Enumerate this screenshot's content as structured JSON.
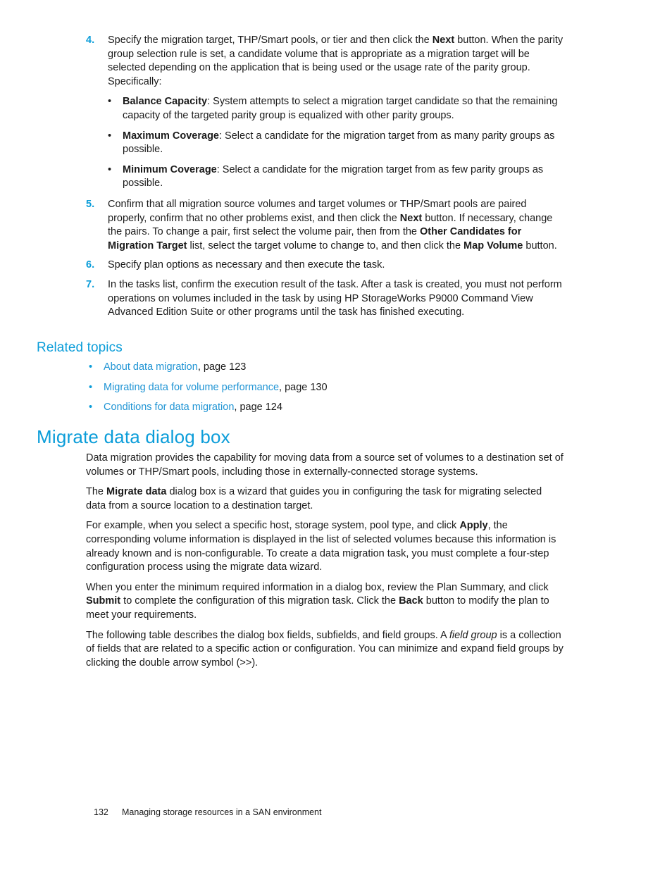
{
  "colors": {
    "accent_blue": "#0b9dd9",
    "link_blue": "#1f94d4",
    "body_text": "#1a1a1a",
    "page_background": "#ffffff"
  },
  "procedure": {
    "steps": [
      {
        "number": "4.",
        "text_parts": [
          {
            "text": "Specify the migration target, THP/Smart pools, or tier and then click the ",
            "style": "normal"
          },
          {
            "text": "Next",
            "style": "bold"
          },
          {
            "text": " button. When the parity group selection rule is set, a candidate volume that is appropriate as a migration target will be selected depending on the application that is being used or the usage rate of the parity group. Specifically:",
            "style": "normal"
          }
        ],
        "sub_items": [
          {
            "bullet": "•",
            "parts": [
              {
                "text": "Balance Capacity",
                "style": "bold"
              },
              {
                "text": ": System attempts to select a migration target candidate so that the remaining capacity of the targeted parity group is equalized with other parity groups.",
                "style": "normal"
              }
            ]
          },
          {
            "bullet": "•",
            "parts": [
              {
                "text": "Maximum Coverage",
                "style": "bold"
              },
              {
                "text": ": Select a candidate for the migration target from as many parity groups as possible.",
                "style": "normal"
              }
            ]
          },
          {
            "bullet": "•",
            "parts": [
              {
                "text": "Minimum Coverage",
                "style": "bold"
              },
              {
                "text": ": Select a candidate for the migration target from as few parity groups as possible.",
                "style": "normal"
              }
            ]
          }
        ]
      },
      {
        "number": "5.",
        "text_parts": [
          {
            "text": "Confirm that all migration source volumes and target volumes or THP/Smart pools are paired properly, confirm that no other problems exist, and then click the ",
            "style": "normal"
          },
          {
            "text": "Next",
            "style": "bold"
          },
          {
            "text": " button. If necessary, change the pairs. To change a pair, first select the volume pair, then from the ",
            "style": "normal"
          },
          {
            "text": "Other Candidates for Migration Target",
            "style": "bold"
          },
          {
            "text": " list, select the target volume to change to, and then click the ",
            "style": "normal"
          },
          {
            "text": "Map Volume",
            "style": "bold"
          },
          {
            "text": " button.",
            "style": "normal"
          }
        ],
        "sub_items": []
      },
      {
        "number": "6.",
        "text_parts": [
          {
            "text": "Specify plan options as necessary and then execute the task.",
            "style": "normal"
          }
        ],
        "sub_items": []
      },
      {
        "number": "7.",
        "text_parts": [
          {
            "text": "In the tasks list, confirm the execution result of the task. After a task is created, you must not perform operations on volumes included in the task by using HP StorageWorks P9000 Command View Advanced Edition Suite or other programs until the task has finished executing.",
            "style": "normal"
          }
        ],
        "sub_items": []
      }
    ]
  },
  "related_topics": {
    "heading": "Related topics",
    "items": [
      {
        "bullet": "•",
        "link_text": "About data migration",
        "suffix": ", page 123"
      },
      {
        "bullet": "•",
        "link_text": "Migrating data for volume performance",
        "suffix": ", page 130"
      },
      {
        "bullet": "•",
        "link_text": "Conditions for data migration",
        "suffix": ", page 124"
      }
    ]
  },
  "section": {
    "heading": "Migrate data dialog box",
    "paragraphs": [
      {
        "parts": [
          {
            "text": "Data migration provides the capability for moving data from a source set of volumes to a destination set of volumes or THP/Smart pools, including those in externally-connected storage systems.",
            "style": "normal"
          }
        ]
      },
      {
        "parts": [
          {
            "text": "The ",
            "style": "normal"
          },
          {
            "text": "Migrate data",
            "style": "bold"
          },
          {
            "text": " dialog box is a wizard that guides you in configuring the task for migrating selected data from a source location to a destination target.",
            "style": "normal"
          }
        ]
      },
      {
        "parts": [
          {
            "text": "For example, when you select a specific host, storage system, pool type, and click ",
            "style": "normal"
          },
          {
            "text": "Apply",
            "style": "bold"
          },
          {
            "text": ", the corresponding volume information is displayed in the list of selected volumes because this information is already known and is non-configurable. To create a data migration task, you must complete a four-step configuration process using the migrate data wizard.",
            "style": "normal"
          }
        ]
      },
      {
        "parts": [
          {
            "text": "When you enter the minimum required information in a dialog box, review the Plan Summary, and click ",
            "style": "normal"
          },
          {
            "text": "Submit",
            "style": "bold"
          },
          {
            "text": " to complete the configuration of this migration task. Click the ",
            "style": "normal"
          },
          {
            "text": "Back",
            "style": "bold"
          },
          {
            "text": " button to modify the plan to meet your requirements.",
            "style": "normal"
          }
        ]
      },
      {
        "parts": [
          {
            "text": "The following table describes the dialog box fields, subfields, and field groups. A ",
            "style": "normal"
          },
          {
            "text": "field group",
            "style": "italic"
          },
          {
            "text": " is a collection of fields that are related to a specific action or configuration. You can minimize and expand field groups by clicking the double arrow symbol (>>).",
            "style": "normal"
          }
        ]
      }
    ]
  },
  "footer": {
    "page_number": "132",
    "title": "Managing storage resources in a SAN environment"
  }
}
